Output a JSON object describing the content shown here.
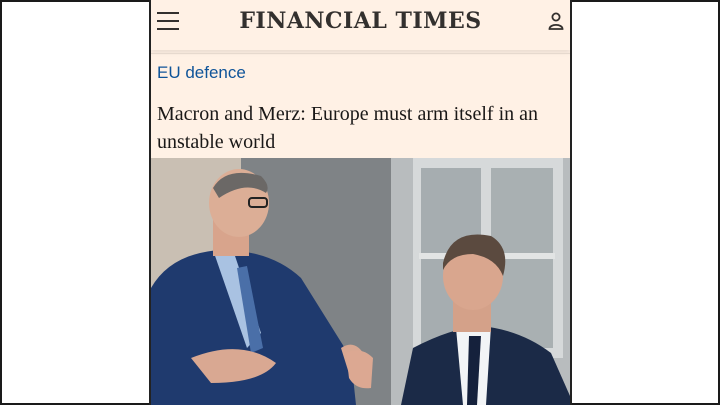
{
  "masthead": {
    "title": "FINANCIAL TIMES"
  },
  "article": {
    "topic": "EU defence",
    "headline": "Macron and Merz: Europe must arm itself in an unstable world"
  },
  "icons": {
    "menu": "hamburger-menu-icon",
    "account": "user-icon"
  },
  "colors": {
    "background": "#fff1e5",
    "topic_link": "#0f5499",
    "text": "#33302e"
  }
}
